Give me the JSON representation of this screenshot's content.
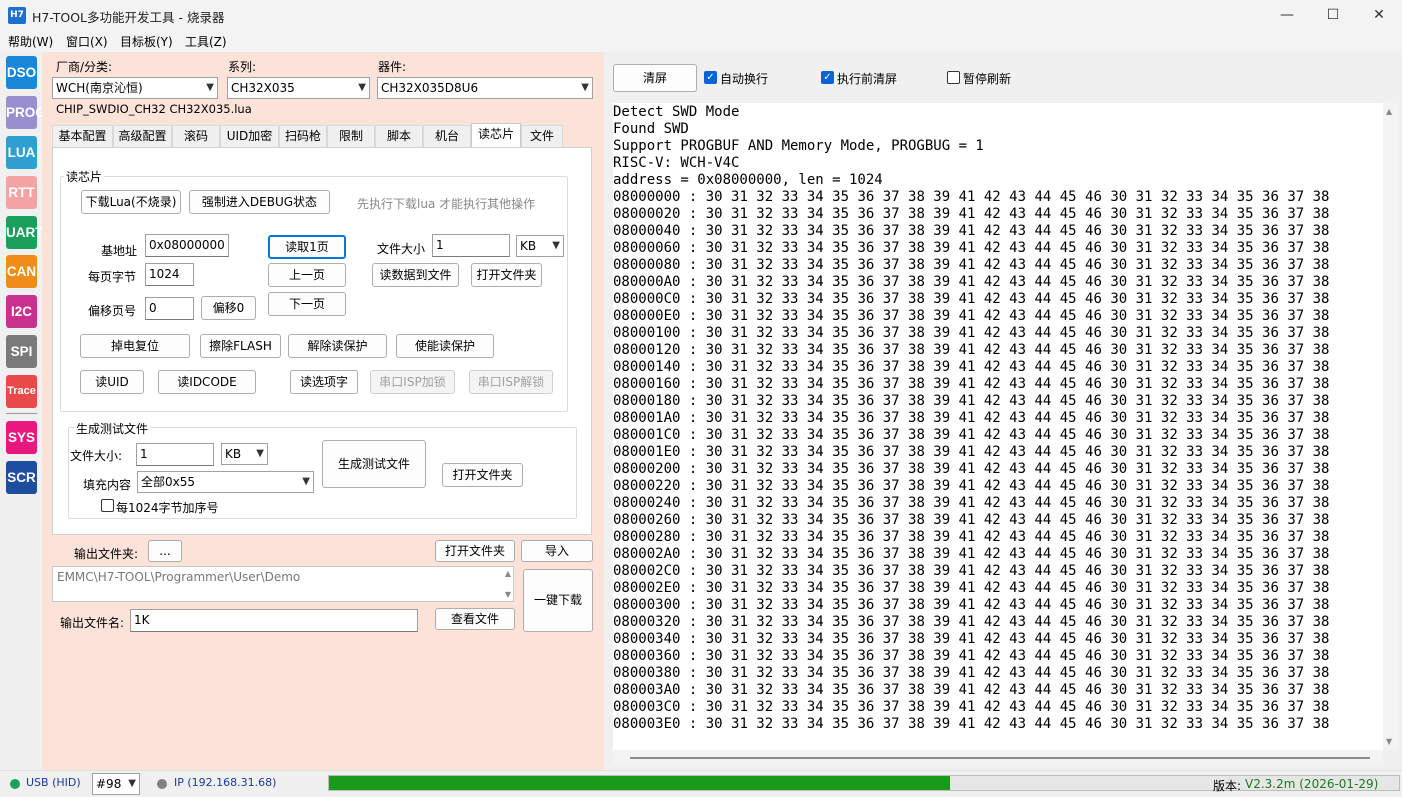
{
  "window": {
    "app_icon_text": "H7",
    "title": "H7-TOOL多功能开发工具 - 烧录器",
    "minimize": "—",
    "maximize": "☐",
    "close": "✕"
  },
  "menu": [
    "帮助(W)",
    "窗口(X)",
    "目标板(Y)",
    "工具(Z)"
  ],
  "sidebar": [
    {
      "label": "DSO",
      "color": "#1a86d8"
    },
    {
      "label": "PROG",
      "color": "#9a8fce"
    },
    {
      "label": "LUA",
      "color": "#2e9fcf"
    },
    {
      "label": "RTT",
      "color": "#f3a3a3"
    },
    {
      "label": "UART",
      "color": "#1aa05a"
    },
    {
      "label": "CAN",
      "color": "#f08c1a"
    },
    {
      "label": "I2C",
      "color": "#c9318e"
    },
    {
      "label": "SPI",
      "color": "#7a7a7a"
    },
    {
      "label": "Trace",
      "color": "#e84a4a"
    },
    {
      "label": "SYS",
      "color": "#e8187e"
    },
    {
      "label": "SCR",
      "color": "#1e4ea0"
    }
  ],
  "selectors": {
    "vendor_label": "厂商/分类:",
    "vendor_value": "WCH(南京沁恒)",
    "series_label": "系列:",
    "series_value": "CH32X035",
    "device_label": "器件:",
    "device_value": "CH32X035D8U6",
    "chip_file": "CHIP_SWDIO_CH32  CH32X035.lua"
  },
  "tabs": [
    "基本配置",
    "高级配置",
    "滚码",
    "UID加密",
    "扫码枪",
    "限制",
    "脚本",
    "机台",
    "读芯片",
    "文件"
  ],
  "read_chip": {
    "group_title": "读芯片",
    "download_lua_btn": "下载Lua(不烧录)",
    "force_debug_btn": "强制进入DEBUG状态",
    "hint": "先执行下载lua 才能执行其他操作",
    "base_addr_label": "基地址",
    "base_addr_value": "0x08000000",
    "page_bytes_label": "每页字节",
    "page_bytes_value": "1024",
    "offset_page_label": "偏移页号",
    "offset_page_value": "0",
    "offset0_btn": "偏移0",
    "read_page_btn": "读取1页",
    "prev_page_btn": "上一页",
    "next_page_btn": "下一页",
    "file_size_label": "文件大小",
    "file_size_value": "1",
    "file_size_unit": "KB",
    "read_to_file_btn": "读数据到文件",
    "open_folder_btn": "打开文件夹",
    "power_reset_btn": "掉电复位",
    "erase_flash_btn": "擦除FLASH",
    "unlock_read_btn": "解除读保护",
    "enable_read_btn": "使能读保护",
    "read_uid_btn": "读UID",
    "read_idcode_btn": "读IDCODE",
    "read_option_btn": "读选项字",
    "isp_lock_btn": "串口ISP加锁",
    "isp_unlock_btn": "串口ISP解锁"
  },
  "gen_test": {
    "group_title": "生成测试文件",
    "size_label": "文件大小:",
    "size_value": "1",
    "size_unit": "KB",
    "fill_label": "填充内容",
    "fill_value": "全部0x55",
    "seq_checkbox_label": "每1024字节加序号",
    "gen_btn": "生成测试文件",
    "open_folder_btn": "打开文件夹"
  },
  "output": {
    "folder_label": "输出文件夹:",
    "browse_btn": "...",
    "open_folder_btn": "打开文件夹",
    "import_btn": "导入",
    "path": "EMMC\\H7-TOOL\\Programmer\\User\\Demo",
    "one_key_btn": "一键下载",
    "filename_label": "输出文件名:",
    "filename_value": "1K",
    "view_file_btn": "查看文件"
  },
  "log_toolbar": {
    "clear_btn": "清屏",
    "auto_wrap": "自动换行",
    "clear_before": "执行前清屏",
    "pause_refresh": "暂停刷新"
  },
  "log": {
    "header": [
      "Detect SWD Mode",
      "Found SWD",
      "Support PROGBUF AND Memory Mode, PROGBUG = 1",
      "RISC-V: WCH-V4C",
      "address = 0x08000000, len = 1024"
    ],
    "row_bytes": "30 31 32 33 34 35 36 37 38 39 41 42 43 44 45 46 30 31 32 33 34 35 36 37 38",
    "addresses": [
      "08000000",
      "08000020",
      "08000040",
      "08000060",
      "08000080",
      "080000A0",
      "080000C0",
      "080000E0",
      "08000100",
      "08000120",
      "08000140",
      "08000160",
      "08000180",
      "080001A0",
      "080001C0",
      "080001E0",
      "08000200",
      "08000220",
      "08000240",
      "08000260",
      "08000280",
      "080002A0",
      "080002C0",
      "080002E0",
      "08000300",
      "08000320",
      "08000340",
      "08000360",
      "08000380",
      "080003A0",
      "080003C0",
      "080003E0"
    ]
  },
  "status": {
    "usb_label": "USB (HID)",
    "usb_color": "#1aa05a",
    "device_no": "#98",
    "ip_label": "IP (192.168.31.68)",
    "ip_color": "#808080",
    "progress": 0.58,
    "progress_color": "#1a9a1a",
    "version_label": "版本:",
    "version_value": "V2.3.2m (2026-01-29)"
  }
}
